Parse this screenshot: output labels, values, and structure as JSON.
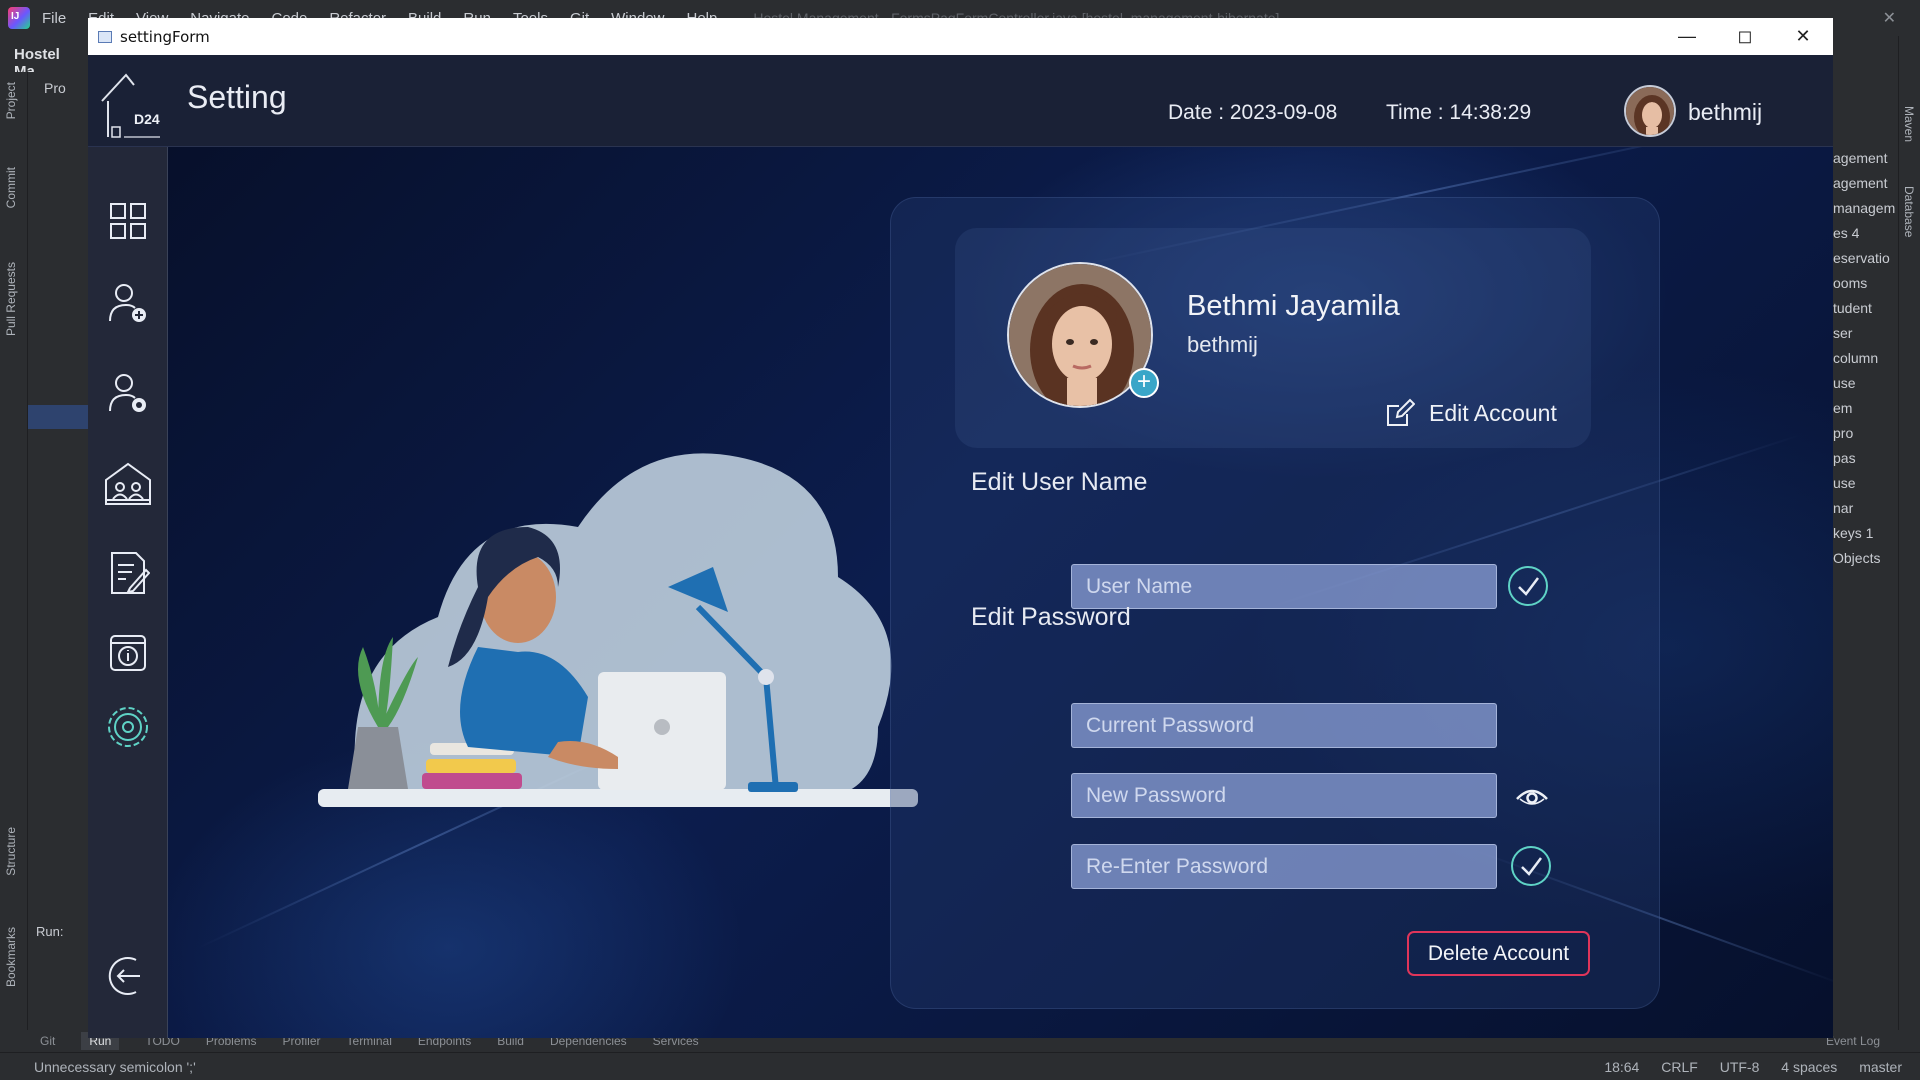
{
  "ide": {
    "menu": [
      "File",
      "Edit",
      "View",
      "Navigate",
      "Code",
      "Refactor",
      "Build",
      "Run",
      "Tools",
      "Git",
      "Window",
      "Help"
    ],
    "window_title": "Hostel Management - FormsPagFormController.java [hostel_management-hibernate]",
    "project_label": "Hostel Ma",
    "left_panel_label": "Pro",
    "left_tabs": [
      "Project",
      "Commit",
      "Pull Requests",
      "Structure",
      "Bookmarks"
    ],
    "right_tabs": [
      "Maven",
      "Database"
    ],
    "tree_items": [
      "agement",
      "agement",
      "managem",
      "es 4",
      "eservatio",
      "ooms",
      "tudent",
      "ser",
      "column",
      "use",
      "em",
      "pro",
      "pas",
      "use",
      "nar",
      "keys 1",
      "Objects"
    ],
    "run_label": "Run:",
    "toolwindows": [
      "Git",
      "Run",
      "TODO",
      "Problems",
      "Profiler",
      "Terminal",
      "Endpoints",
      "Build",
      "Dependencies",
      "Services"
    ],
    "active_toolwindow": "Run",
    "event_log": "Event Log",
    "status_message": "Unnecessary semicolon ';'",
    "status_right": [
      "18:64",
      "CRLF",
      "UTF-8",
      "4 spaces",
      "master"
    ]
  },
  "app": {
    "window_title": "settingForm",
    "logo_text": "D24",
    "page_title": "Setting",
    "date_label": "Date : 2023-09-08",
    "time_label": "Time : 14:38:29",
    "header_username": "bethmij",
    "sidebar_items": [
      "dashboard",
      "add-student",
      "manage-student",
      "rooms",
      "reservation",
      "report",
      "settings",
      "logout"
    ],
    "active_sidebar": "settings",
    "profile": {
      "full_name": "Bethmi Jayamila",
      "username": "bethmij",
      "edit_account_label": "Edit Account"
    },
    "edit_username": {
      "title": "Edit User Name",
      "placeholder": "User Name"
    },
    "edit_password": {
      "title": "Edit Password",
      "current_placeholder": "Current Password",
      "new_placeholder": "New Password",
      "reenter_placeholder": "Re-Enter Password"
    },
    "delete_label": "Delete Account",
    "colors": {
      "accent_teal": "#5fd3c6",
      "delete_border": "#e0355a",
      "input_fill": "#8ca0d7",
      "header_bg": "#1a2136",
      "sidebar_bg": "#232839"
    }
  }
}
